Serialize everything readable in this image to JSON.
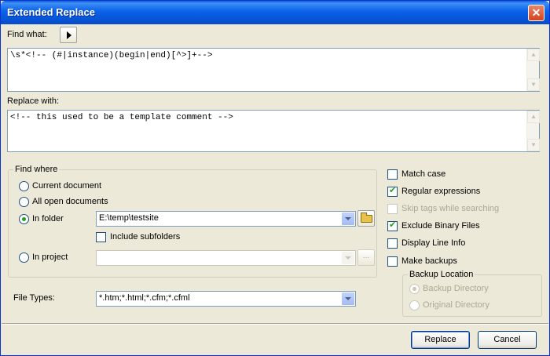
{
  "window": {
    "title": "Extended Replace",
    "close_glyph": "✕"
  },
  "find": {
    "label": "Find what:",
    "value": "\\s*<!-- (#|instance)(begin|end)[^>]+-->"
  },
  "replace": {
    "label": "Replace with:",
    "value": "<!-- this used to be a template comment -->"
  },
  "find_where": {
    "legend": "Find where",
    "current_document": "Current document",
    "all_open_documents": "All open documents",
    "in_folder": "In folder",
    "folder_value": "E:\\temp\\testsite",
    "include_subfolders": "Include subfolders",
    "in_project": "In project",
    "project_value": "",
    "browse_dots": "...",
    "selected": "in_folder"
  },
  "file_types": {
    "label": "File Types:",
    "value": "*.htm;*.html;*.cfm;*.cfml"
  },
  "options": {
    "match_case": "Match case",
    "regular_expressions": "Regular expressions",
    "skip_tags": "Skip tags while searching",
    "exclude_binary": "Exclude Binary Files",
    "display_line_info": "Display Line Info",
    "make_backups": "Make backups",
    "states": {
      "match_case": false,
      "regular_expressions": true,
      "skip_tags": false,
      "exclude_binary": true,
      "display_line_info": false,
      "make_backups": false
    }
  },
  "backup": {
    "legend": "Backup Location",
    "backup_directory": "Backup Directory",
    "original_directory": "Original Directory"
  },
  "buttons": {
    "replace": "Replace",
    "cancel": "Cancel"
  },
  "colors": {
    "title_bar": "#0a62e8",
    "dialog_bg": "#ece9d8",
    "check_mark": "#21a121"
  }
}
